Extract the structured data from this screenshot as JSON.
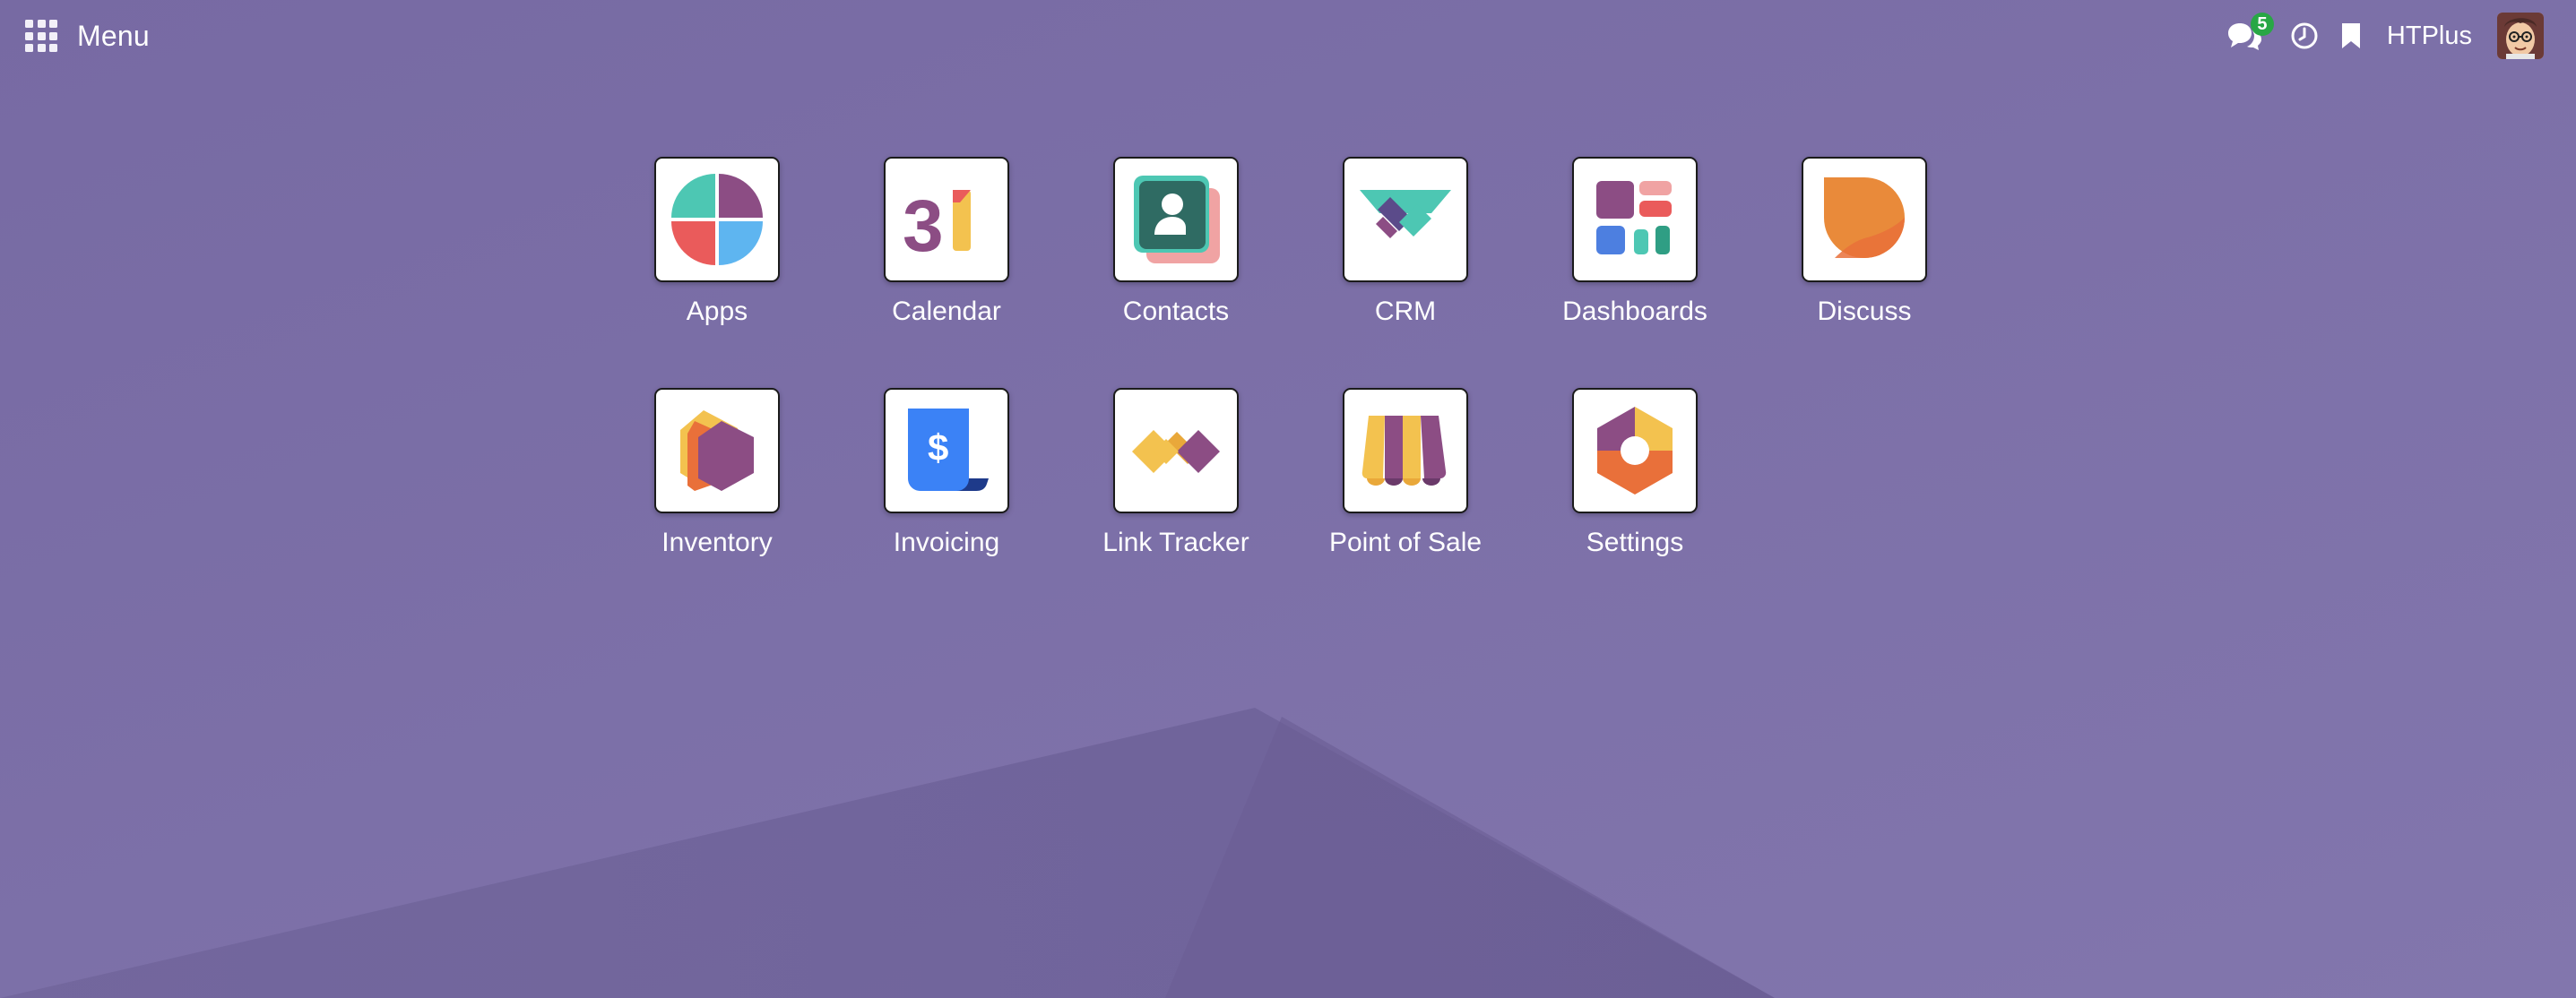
{
  "navbar": {
    "menu_label": "Menu",
    "messages_badge": "5",
    "company": "HTPlus"
  },
  "colors": {
    "background": "#7a6fa6",
    "tile_background": "#ffffff",
    "badge": "#28a745"
  },
  "apps": [
    {
      "label": "Apps",
      "icon": "apps-icon"
    },
    {
      "label": "Calendar",
      "icon": "calendar-icon"
    },
    {
      "label": "Contacts",
      "icon": "contacts-icon"
    },
    {
      "label": "CRM",
      "icon": "crm-icon"
    },
    {
      "label": "Dashboards",
      "icon": "dashboards-icon"
    },
    {
      "label": "Discuss",
      "icon": "discuss-icon"
    },
    {
      "label": "Inventory",
      "icon": "inventory-icon"
    },
    {
      "label": "Invoicing",
      "icon": "invoicing-icon"
    },
    {
      "label": "Link Tracker",
      "icon": "link-tracker-icon"
    },
    {
      "label": "Point of Sale",
      "icon": "point-of-sale-icon"
    },
    {
      "label": "Settings",
      "icon": "settings-icon"
    }
  ],
  "calendar_icon_text": "31"
}
